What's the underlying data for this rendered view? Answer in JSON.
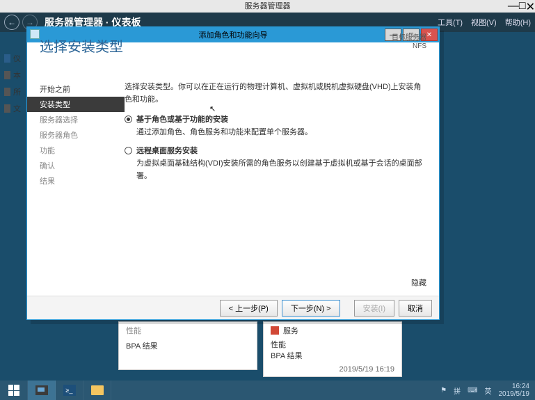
{
  "outer": {
    "title": "服务器管理器"
  },
  "topbar": {
    "breadcrumb": "服务器管理器 · 仪表板"
  },
  "menu": {
    "tools": "工具(T)",
    "view": "视图(V)",
    "help": "帮助(H)"
  },
  "rail": {
    "dashboard": "仪",
    "local": "本",
    "all": "所",
    "file": "文"
  },
  "wizard": {
    "title": "添加角色和功能向导",
    "heading": "选择安装类型",
    "target_label": "目标服务器",
    "target_server": "NFS",
    "steps": {
      "before": "开始之前",
      "type": "安装类型",
      "server_sel": "服务器选择",
      "server_role": "服务器角色",
      "features": "功能",
      "confirm": "确认",
      "results": "结果"
    },
    "intro": "选择安装类型。你可以在正在运行的物理计算机、虚拟机或脱机虚拟硬盘(VHD)上安装角色和功能。",
    "opt1": {
      "label": "基于角色或基于功能的安装",
      "desc": "通过添加角色、角色服务和功能来配置单个服务器。"
    },
    "opt2": {
      "label": "远程桌面服务安装",
      "desc": "为虚拟桌面基础结构(VDI)安装所需的角色服务以创建基于虚拟机或基于会话的桌面部署。"
    },
    "hide": "隐藏",
    "buttons": {
      "prev": "< 上一步(P)",
      "next": "下一步(N) >",
      "install": "安装(I)",
      "cancel": "取消"
    }
  },
  "bg": {
    "bpa": "BPA 结果",
    "svc": "服务",
    "perf": "性能",
    "ts": "2019/5/19 16:19"
  },
  "tray": {
    "ime": "拼",
    "lang": "英",
    "time": "16:24",
    "date": "2019/5/19"
  }
}
